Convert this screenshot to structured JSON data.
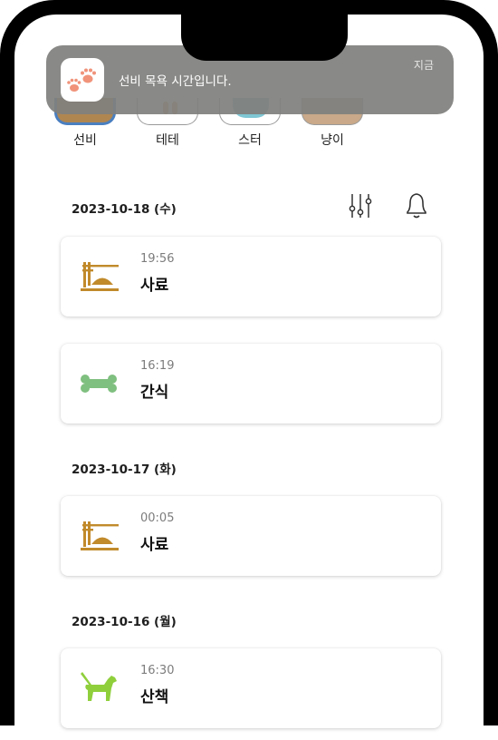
{
  "notification": {
    "message": "선비 목욕 시간입니다.",
    "time": "지금",
    "icon": "paw-icon"
  },
  "pets": [
    {
      "name": "선비",
      "selected": true
    },
    {
      "name": "테테",
      "selected": false
    },
    {
      "name": "스터",
      "selected": false
    },
    {
      "name": "냥이",
      "selected": false
    }
  ],
  "toolbar": {
    "filter_icon": "sliders-icon",
    "alarm_icon": "bell-icon"
  },
  "days": [
    {
      "date": "2023-10-18 (수)",
      "records": [
        {
          "time": "19:56",
          "label": "사료",
          "icon": "feed-bowl-icon"
        },
        {
          "time": "16:19",
          "label": "간식",
          "icon": "bone-icon"
        }
      ]
    },
    {
      "date": "2023-10-17 (화)",
      "records": [
        {
          "time": "00:05",
          "label": "사료",
          "icon": "feed-bowl-icon"
        }
      ]
    },
    {
      "date": "2023-10-16 (월)",
      "records": [
        {
          "time": "16:30",
          "label": "산책",
          "icon": "dog-walk-icon"
        }
      ]
    }
  ],
  "colors": {
    "feed": "#c18a2b",
    "snack": "#7fbf7f",
    "walk": "#8fcf3c",
    "accent": "#4a7fc0"
  }
}
